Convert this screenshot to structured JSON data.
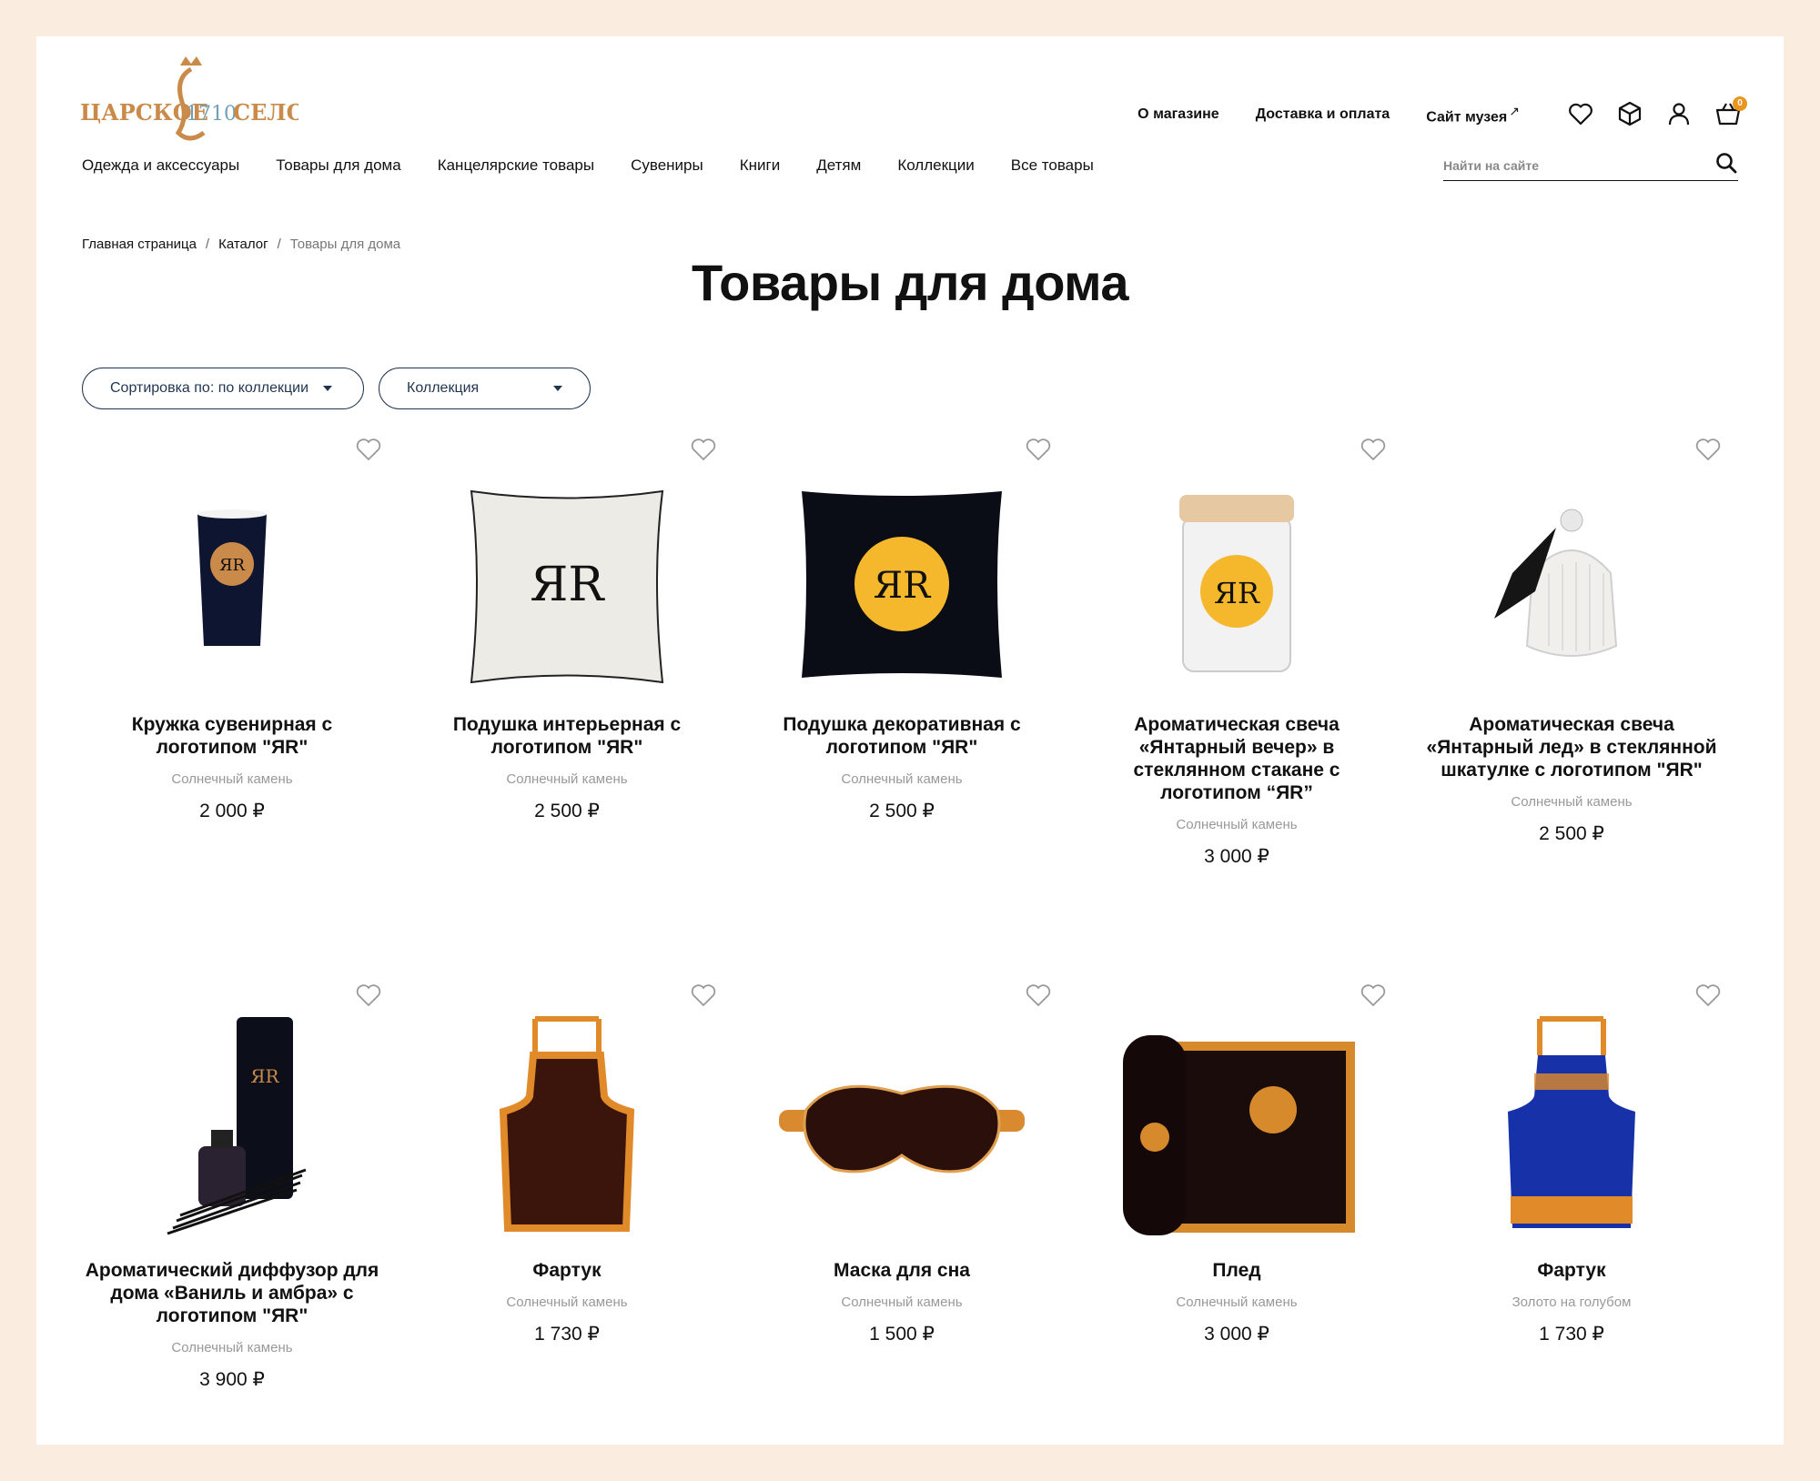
{
  "logo": {
    "text_left": "ЦАРСКОЕ",
    "year": "1710",
    "text_right": "СЕЛО"
  },
  "topnav": {
    "about": "О магазине",
    "delivery": "Доставка и оплата",
    "museum": "Сайт музея",
    "cart_count": "0"
  },
  "catnav": [
    "Одежда и аксессуары",
    "Товары для дома",
    "Канцелярские товары",
    "Сувениры",
    "Книги",
    "Детям",
    "Коллекции",
    "Все товары"
  ],
  "search": {
    "placeholder": "Найти на сайте"
  },
  "breadcrumb": {
    "home": "Главная страница",
    "catalog": "Каталог",
    "current": "Товары для дома",
    "sep": "/"
  },
  "page_title": "Товары для дома",
  "filters": {
    "sort": "Сортировка по: по коллекции",
    "collection": "Коллекция"
  },
  "products": [
    {
      "name": "Кружка сувенирная с логотипом \"ЯR\"",
      "collection": "Солнечный камень",
      "price": "2 000 ₽"
    },
    {
      "name": "Подушка интерьерная с логотипом \"ЯR\"",
      "collection": "Солнечный камень",
      "price": "2 500 ₽"
    },
    {
      "name": "Подушка декоративная с логотипом \"ЯR\"",
      "collection": "Солнечный камень",
      "price": "2 500 ₽"
    },
    {
      "name": "Ароматическая свеча «Янтарный вечер» в стеклянном стакане с логотипом “ЯR”",
      "collection": "Солнечный камень",
      "price": "3 000 ₽"
    },
    {
      "name": "Ароматическая свеча «Янтарный лед» в стеклянной шкатулке с логотипом \"ЯR\"",
      "collection": "Солнечный камень",
      "price": "2 500 ₽"
    },
    {
      "name": "Ароматический диффузор для дома «Ваниль и амбра» с логотипом \"ЯR\"",
      "collection": "Солнечный камень",
      "price": "3 900 ₽"
    },
    {
      "name": "Фартук",
      "collection": "Солнечный камень",
      "price": "1 730 ₽"
    },
    {
      "name": "Маска для сна",
      "collection": "Солнечный камень",
      "price": "1 500 ₽"
    },
    {
      "name": "Плед",
      "collection": "Солнечный камень",
      "price": "3 000 ₽"
    },
    {
      "name": "Фартук",
      "collection": "Золото на голубом",
      "price": "1 730 ₽"
    }
  ],
  "colors": {
    "background": "#fbece0",
    "accent": "#e8961f",
    "pill_border": "#1f3550",
    "muted": "#999999"
  }
}
